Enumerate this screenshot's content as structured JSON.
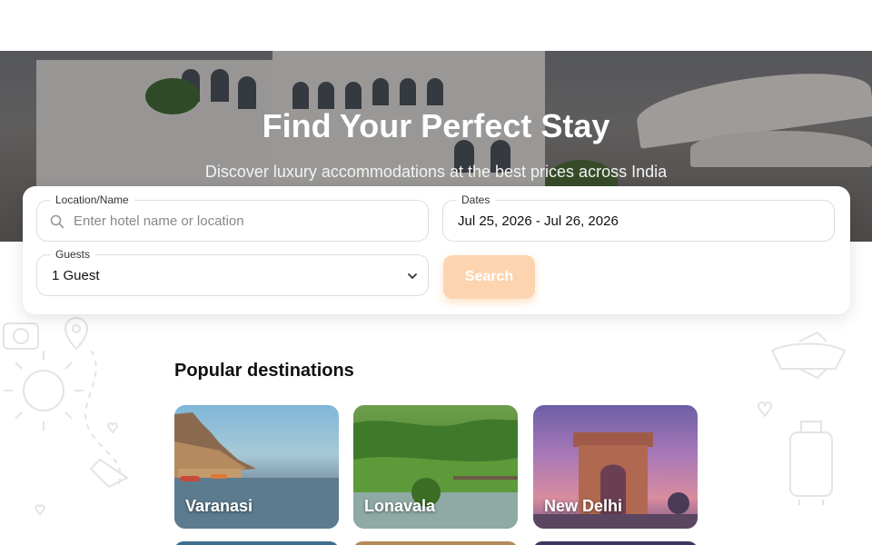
{
  "hero": {
    "title": "Find Your Perfect Stay",
    "subtitle": "Discover luxury accommodations at the best prices across India"
  },
  "search": {
    "location_label": "Location/Name",
    "location_placeholder": "Enter hotel name or location",
    "dates_label": "Dates",
    "dates_value": "Jul 25, 2026 - Jul 26, 2026",
    "guests_label": "Guests",
    "guests_value": "1 Guest",
    "search_button": "Search"
  },
  "popular": {
    "title": "Popular destinations",
    "destinations": [
      {
        "name": "Varanasi"
      },
      {
        "name": "Lonavala"
      },
      {
        "name": "New Delhi"
      }
    ]
  },
  "colors": {
    "accent": "#fcd5b0",
    "text": "#111111",
    "border": "#dedede"
  }
}
